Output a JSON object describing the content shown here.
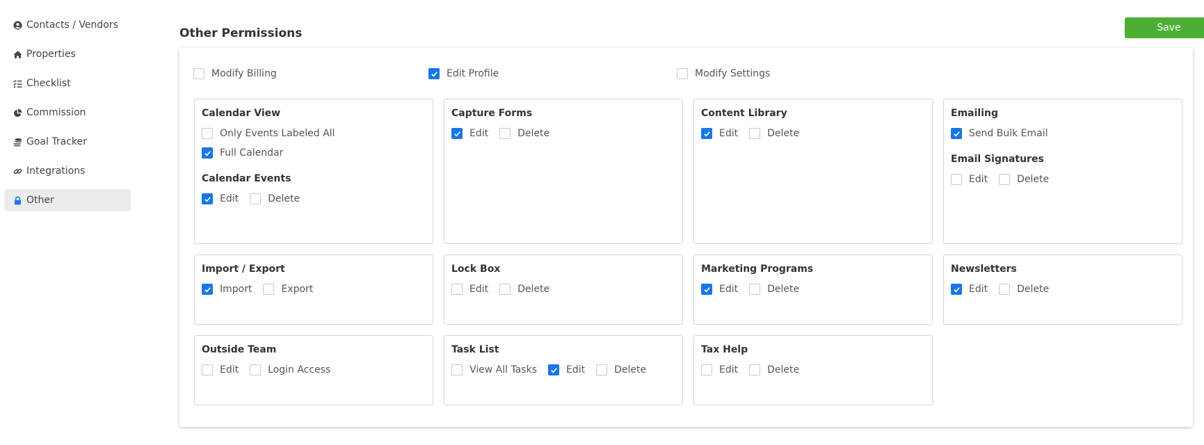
{
  "sidebar": {
    "items": [
      {
        "label": "Contacts / Vendors",
        "icon": "user-circle-icon"
      },
      {
        "label": "Properties",
        "icon": "home-icon"
      },
      {
        "label": "Checklist",
        "icon": "checklist-icon"
      },
      {
        "label": "Commission",
        "icon": "pie-chart-icon"
      },
      {
        "label": "Goal Tracker",
        "icon": "coins-stack-icon"
      },
      {
        "label": "Integrations",
        "icon": "link-icon"
      },
      {
        "label": "Other",
        "icon": "lock-icon",
        "active": true
      }
    ]
  },
  "header": {
    "title": "Other Permissions",
    "save_label": "Save"
  },
  "colors": {
    "accent": "#1877e6",
    "save": "#4caf34",
    "active_bg": "#ececec"
  },
  "top_perms": [
    {
      "label": "Modify Billing",
      "checked": false
    },
    {
      "label": "Edit Profile",
      "checked": true
    },
    {
      "label": "Modify Settings",
      "checked": false
    }
  ],
  "groups": {
    "calendar_view": {
      "title": "Calendar View",
      "options": [
        {
          "label": "Only Events Labeled All",
          "checked": false
        },
        {
          "label": "Full Calendar",
          "checked": true
        }
      ],
      "sub_title": "Calendar Events",
      "sub_options": [
        {
          "label": "Edit",
          "checked": true
        },
        {
          "label": "Delete",
          "checked": false
        }
      ]
    },
    "capture_forms": {
      "title": "Capture Forms",
      "options": [
        {
          "label": "Edit",
          "checked": true
        },
        {
          "label": "Delete",
          "checked": false
        }
      ]
    },
    "content_library": {
      "title": "Content Library",
      "options": [
        {
          "label": "Edit",
          "checked": true
        },
        {
          "label": "Delete",
          "checked": false
        }
      ]
    },
    "emailing": {
      "title": "Emailing",
      "options": [
        {
          "label": "Send Bulk Email",
          "checked": true
        }
      ],
      "sub_title": "Email Signatures",
      "sub_options": [
        {
          "label": "Edit",
          "checked": false
        },
        {
          "label": "Delete",
          "checked": false
        }
      ]
    },
    "import_export": {
      "title": "Import / Export",
      "options": [
        {
          "label": "Import",
          "checked": true
        },
        {
          "label": "Export",
          "checked": false
        }
      ]
    },
    "lock_box": {
      "title": "Lock Box",
      "options": [
        {
          "label": "Edit",
          "checked": false
        },
        {
          "label": "Delete",
          "checked": false
        }
      ]
    },
    "marketing_programs": {
      "title": "Marketing Programs",
      "options": [
        {
          "label": "Edit",
          "checked": true
        },
        {
          "label": "Delete",
          "checked": false
        }
      ]
    },
    "newsletters": {
      "title": "Newsletters",
      "options": [
        {
          "label": "Edit",
          "checked": true
        },
        {
          "label": "Delete",
          "checked": false
        }
      ]
    },
    "outside_team": {
      "title": "Outside Team",
      "options": [
        {
          "label": "Edit",
          "checked": false
        },
        {
          "label": "Login Access",
          "checked": false
        }
      ]
    },
    "task_list": {
      "title": "Task List",
      "options": [
        {
          "label": "View All Tasks",
          "checked": false
        },
        {
          "label": "Edit",
          "checked": true
        },
        {
          "label": "Delete",
          "checked": false
        }
      ]
    },
    "tax_help": {
      "title": "Tax Help",
      "options": [
        {
          "label": "Edit",
          "checked": false
        },
        {
          "label": "Delete",
          "checked": false
        }
      ]
    }
  }
}
